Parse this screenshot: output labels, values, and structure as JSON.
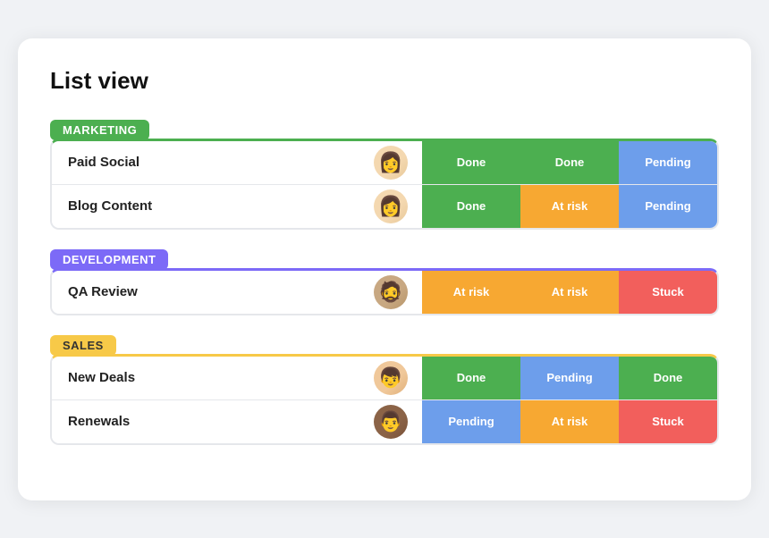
{
  "page": {
    "title": "List view"
  },
  "groups": [
    {
      "id": "marketing",
      "label": "MARKETING",
      "colorClass": "group-marketing",
      "rows": [
        {
          "name": "Paid Social",
          "avatar": "👩",
          "avatarClass": "avatar-female-blonde",
          "statuses": [
            {
              "label": "Done",
              "class": "status-done"
            },
            {
              "label": "Done",
              "class": "status-done"
            },
            {
              "label": "Pending",
              "class": "status-pending"
            }
          ]
        },
        {
          "name": "Blog Content",
          "avatar": "👩",
          "avatarClass": "avatar-female-dark",
          "statuses": [
            {
              "label": "Done",
              "class": "status-done"
            },
            {
              "label": "At risk",
              "class": "status-at-risk"
            },
            {
              "label": "Pending",
              "class": "status-pending"
            }
          ]
        }
      ]
    },
    {
      "id": "development",
      "label": "DEVELOPMENT",
      "colorClass": "group-development",
      "rows": [
        {
          "name": "QA Review",
          "avatar": "🧔",
          "avatarClass": "avatar-male-beard",
          "statuses": [
            {
              "label": "At risk",
              "class": "status-at-risk"
            },
            {
              "label": "At risk",
              "class": "status-at-risk"
            },
            {
              "label": "Stuck",
              "class": "status-stuck"
            }
          ]
        }
      ]
    },
    {
      "id": "sales",
      "label": "SALES",
      "colorClass": "group-sales",
      "rows": [
        {
          "name": "New Deals",
          "avatar": "👦",
          "avatarClass": "avatar-male-light",
          "statuses": [
            {
              "label": "Done",
              "class": "status-done"
            },
            {
              "label": "Pending",
              "class": "status-pending"
            },
            {
              "label": "Done",
              "class": "status-done"
            }
          ]
        },
        {
          "name": "Renewals",
          "avatar": "👨",
          "avatarClass": "avatar-male-dark",
          "statuses": [
            {
              "label": "Pending",
              "class": "status-pending"
            },
            {
              "label": "At risk",
              "class": "status-at-risk"
            },
            {
              "label": "Stuck",
              "class": "status-stuck"
            }
          ]
        }
      ]
    }
  ]
}
